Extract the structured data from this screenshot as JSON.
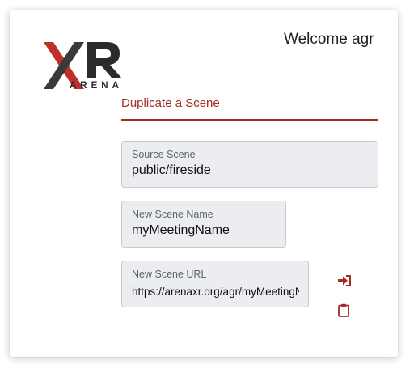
{
  "brand": {
    "logo_text": "XR",
    "logo_subtext": "ARENA",
    "colors": {
      "red": "#c0302a",
      "dark": "#2b2b2b"
    }
  },
  "header": {
    "welcome": "Welcome agr"
  },
  "tab": {
    "title": "Duplicate a Scene"
  },
  "form": {
    "source": {
      "label": "Source Scene",
      "value": "public/fireside"
    },
    "name": {
      "label": "New Scene Name",
      "value": "myMeetingName"
    },
    "url": {
      "label": "New Scene URL",
      "value": "https://arenaxr.org/agr/myMeetingName"
    }
  },
  "icons": {
    "open": "sign-in-icon",
    "copy": "clipboard-icon"
  },
  "colors": {
    "accent": "#a52a22",
    "field_bg": "#ebedf0"
  }
}
